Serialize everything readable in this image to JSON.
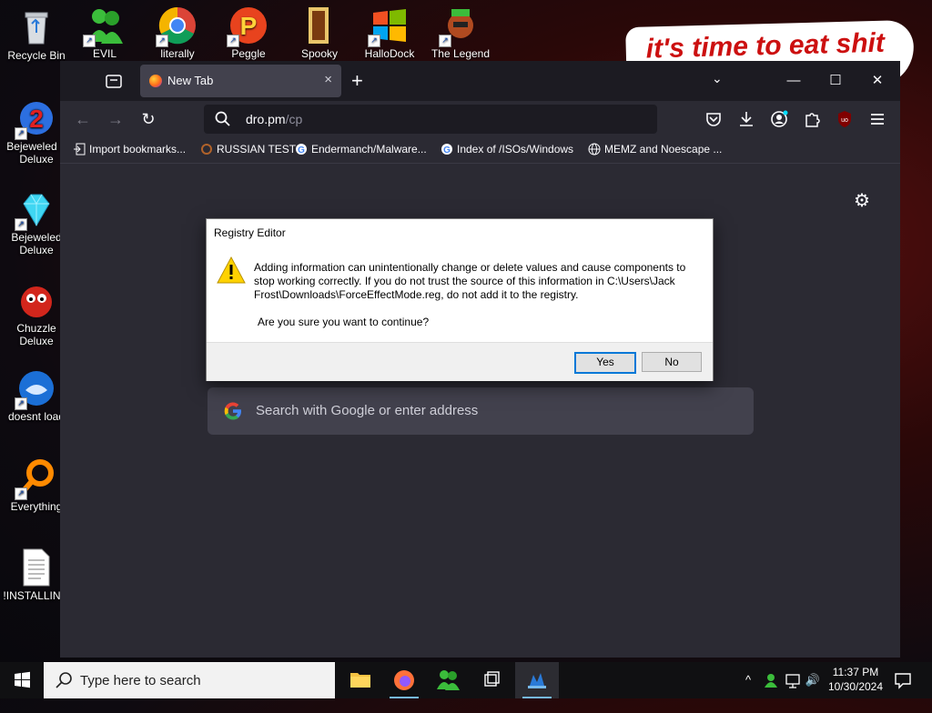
{
  "desktop": {
    "left_icons": [
      {
        "label": "Recycle Bin"
      },
      {
        "label": "Bejeweled 2 Deluxe"
      },
      {
        "label": "Bejeweled Deluxe"
      },
      {
        "label": "Chuzzle Deluxe"
      },
      {
        "label": "doesnt load"
      },
      {
        "label": "Everything"
      },
      {
        "label": "!INSTALLIN..."
      }
    ],
    "top_icons": [
      {
        "label": "EVIL GREEN"
      },
      {
        "label": "literally"
      },
      {
        "label": "Peggle Nights"
      },
      {
        "label": "Spooky"
      },
      {
        "label": "HalloDock"
      },
      {
        "label": "The Legend"
      }
    ],
    "meme_text": "it's time to eat shit"
  },
  "browser": {
    "tab": {
      "title": "New Tab",
      "close": "×"
    },
    "new_tab": "+",
    "tab_list": "⌄",
    "window_controls": {
      "minimize": "—",
      "maximize": "☐",
      "close": "✕"
    },
    "nav": {
      "back": "←",
      "forward": "→",
      "reload": "↻"
    },
    "url": {
      "host": "dro.pm",
      "path": "/cp"
    },
    "toolbar_icons": [
      "pocket-icon",
      "download-icon",
      "account-icon",
      "extensions-icon",
      "ublock-icon",
      "menu-icon"
    ],
    "bookmarks": [
      {
        "label": "Import bookmarks..."
      },
      {
        "label": "RUSSIAN TEST"
      },
      {
        "label": "Endermanch/Malware..."
      },
      {
        "label": "Index of /ISOs/Windows"
      },
      {
        "label": "MEMZ and Noescape ..."
      }
    ],
    "search_placeholder": "Search with Google or enter address"
  },
  "dialog": {
    "title": "Registry Editor",
    "message": "Adding information can unintentionally change or delete values and cause components to stop working correctly. If you do not trust the source of this information in C:\\Users\\Jack Frost\\Downloads\\ForceEffectMode.reg, do not add it to the registry.",
    "question": "Are you sure you want to continue?",
    "yes": "Yes",
    "no": "No"
  },
  "taskbar": {
    "search_placeholder": "Type here to search",
    "time": "11:37 PM",
    "date": "10/30/2024",
    "tray": {
      "chevron": "^",
      "volume": "🔊"
    }
  },
  "colors": {
    "browser_bg": "#2b2a33",
    "tabbar_bg": "#1c1b22",
    "dialog_accent": "#0078d7",
    "meme_red": "#cc1010"
  }
}
